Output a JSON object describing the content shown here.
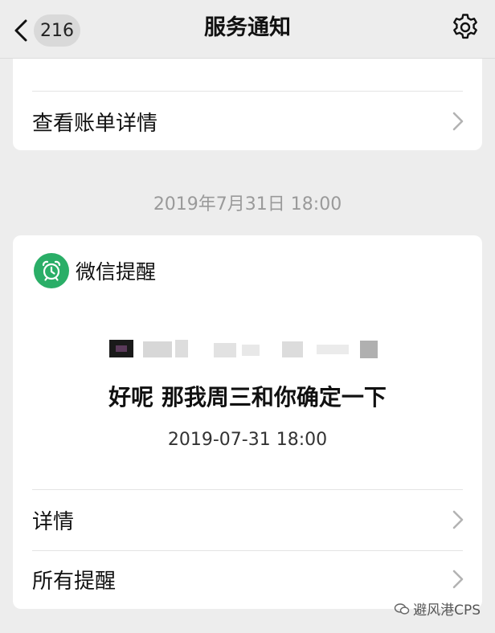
{
  "header": {
    "back_count": "216",
    "title": "服务通知"
  },
  "top_card": {
    "row_label": "查看账单详情"
  },
  "timestamp": "2019年7月31日 18:00",
  "notification": {
    "app_name": "微信提醒",
    "message": "好呢 那我周三和你确定一下",
    "time": "2019-07-31 18:00",
    "rows": [
      "详情",
      "所有提醒"
    ]
  },
  "watermark": {
    "text": "避风港CPS"
  },
  "icons": {
    "back": "chevron-left-icon",
    "settings": "gear-icon",
    "app": "alarm-clock-icon",
    "row_chevron": "chevron-right-icon"
  },
  "colors": {
    "background": "#ededed",
    "card": "#ffffff",
    "app_green": "#2aae67",
    "timestamp_gray": "#9a9a9a"
  }
}
